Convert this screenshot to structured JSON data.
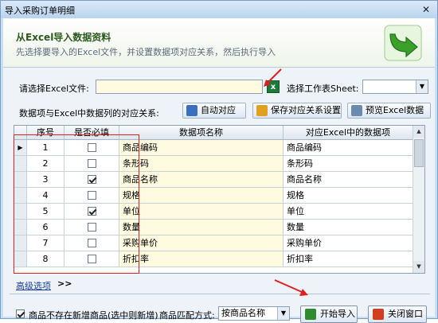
{
  "window": {
    "title": "导入采购订单明细",
    "close": "✕"
  },
  "header": {
    "title": "从Excel导入数据资料",
    "subtitle": "先选择要导入的Excel文件，并设置数据项对应关系，然后执行导入"
  },
  "file": {
    "label": "请选择Excel文件:",
    "value": "",
    "icon": "excel-file-icon"
  },
  "sheet": {
    "label": "选择工作表Sheet:",
    "value": ""
  },
  "mapping": {
    "label": "数据项与Excel中数据列的对应关系:",
    "auto_btn": "自动对应",
    "save_btn": "保存对应关系设置",
    "preview_btn": "预览Excel数据"
  },
  "grid": {
    "headers": [
      "序号",
      "是否必填",
      "数据项名称",
      "对应Excel中的数据项"
    ],
    "rows": [
      {
        "no": "1",
        "required": false,
        "name": "商品编码",
        "map": "商品编码",
        "current": true
      },
      {
        "no": "2",
        "required": false,
        "name": "条形码",
        "map": "条形码",
        "current": false
      },
      {
        "no": "3",
        "required": true,
        "name": "商品名称",
        "map": "商品名称",
        "current": false
      },
      {
        "no": "4",
        "required": false,
        "name": "规格",
        "map": "规格",
        "current": false
      },
      {
        "no": "5",
        "required": true,
        "name": "单位",
        "map": "单位",
        "current": false
      },
      {
        "no": "6",
        "required": false,
        "name": "数量",
        "map": "数量",
        "current": false
      },
      {
        "no": "7",
        "required": false,
        "name": "采购单价",
        "map": "采购单价",
        "current": false
      },
      {
        "no": "8",
        "required": false,
        "name": "折扣率",
        "map": "折扣率",
        "current": false
      }
    ]
  },
  "advanced": {
    "label": "高级选项",
    "chevron": ">>"
  },
  "bottom": {
    "create_new_label": "商品不存在新增商品(选中则新增)",
    "create_new_checked": true,
    "match_label": "商品匹配方式:",
    "match_value": "按商品名称",
    "start_btn": "开始导入",
    "close_btn": "关闭窗口"
  },
  "colors": {
    "accent_green": "#3aa02a",
    "highlight_red": "#e02020",
    "titlebar": "#c9dff5"
  }
}
